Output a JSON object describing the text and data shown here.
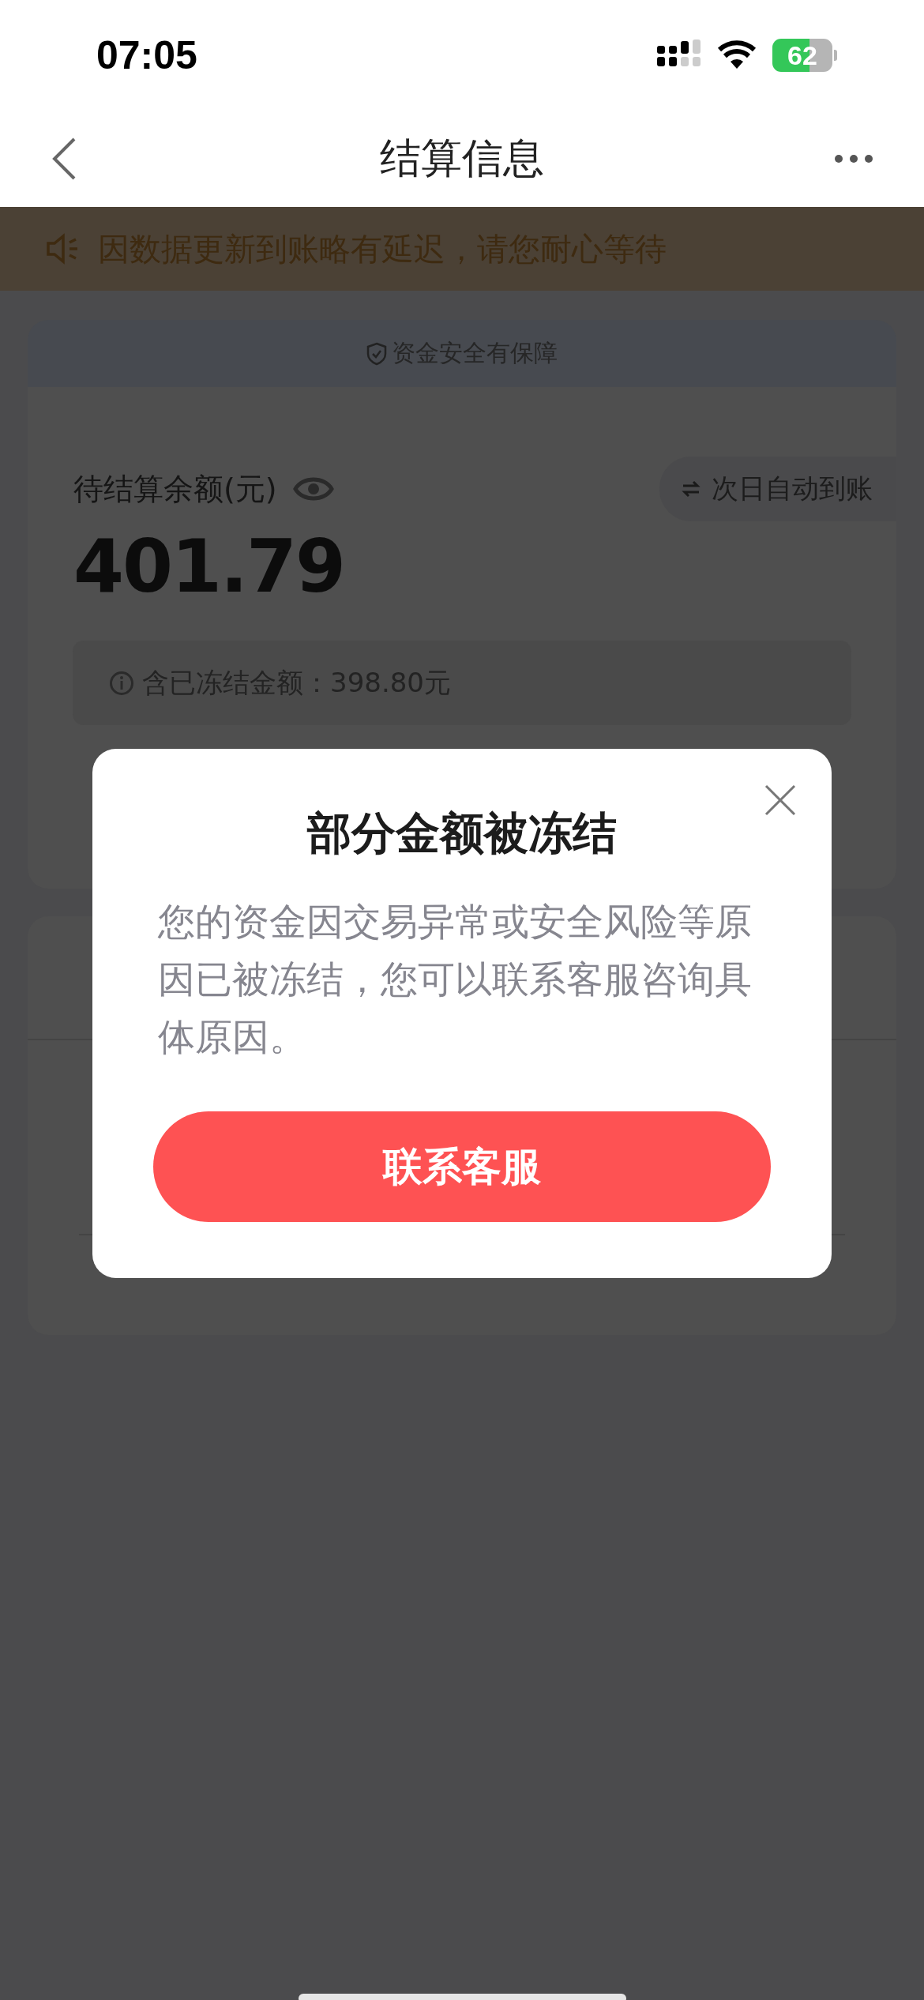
{
  "status_bar": {
    "time": "07:05",
    "battery": "62"
  },
  "nav": {
    "title": "结算信息"
  },
  "notice": {
    "text": "因数据更新到账略有延迟，请您耐心等待"
  },
  "balance_card": {
    "security": "资金安全有保障",
    "label": "待结算余额(元)",
    "amount": "401.79",
    "payout": "次日自动到账",
    "frozen": "含已冻结金额：398.80元"
  },
  "dialog": {
    "title": "部分金额被冻结",
    "body": "您的资金因交易异常或安全风险等原因已被冻结，您可以联系客服咨询具体原因。",
    "button": "联系客服"
  }
}
